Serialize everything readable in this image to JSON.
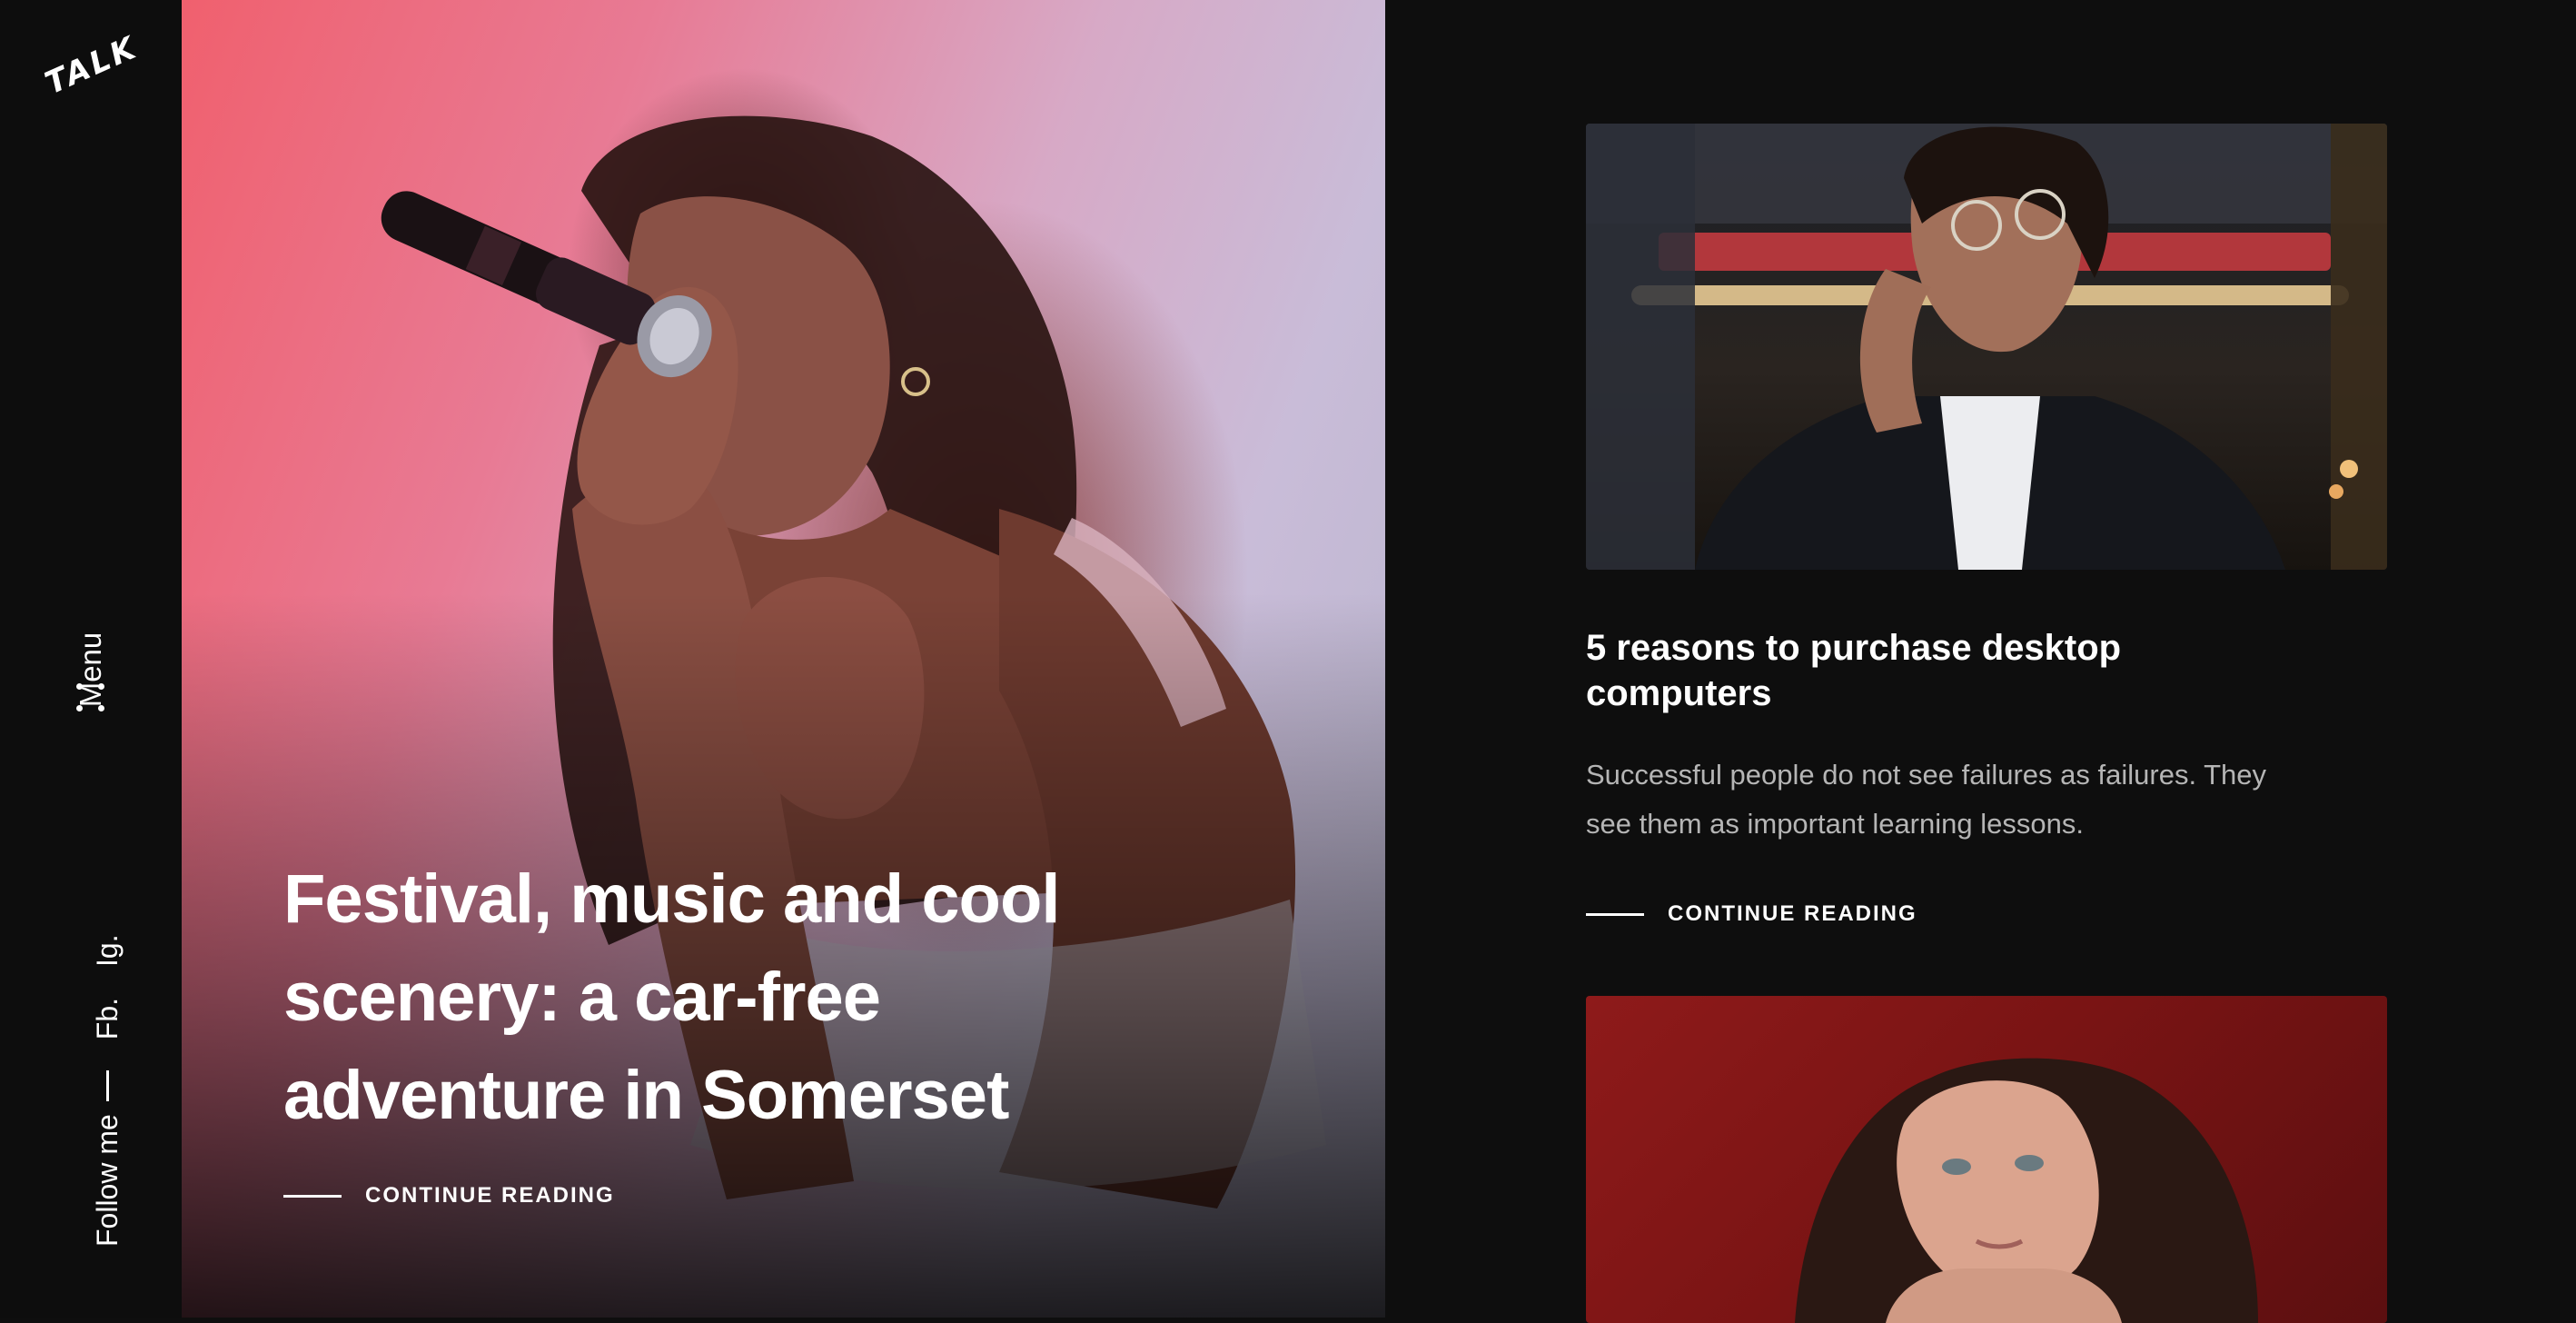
{
  "sidebar": {
    "logo": "TALK",
    "menu_label": "Menu",
    "follow_label": "Follow me",
    "social_links": [
      "Fb.",
      "Ig."
    ]
  },
  "hero": {
    "title": "Festival, music and cool scenery: a car-free adventure in Somerset",
    "read_more": "CONTINUE READING"
  },
  "posts": [
    {
      "title": "5 reasons to purchase desktop computers",
      "excerpt": "Successful people do not see failures as failures. They see them as important learning lessons.",
      "read_more": "CONTINUE READING"
    }
  ],
  "colors": {
    "background": "#0e0e0e",
    "text": "#ffffff",
    "excerpt_text": "#b5b5b5"
  }
}
